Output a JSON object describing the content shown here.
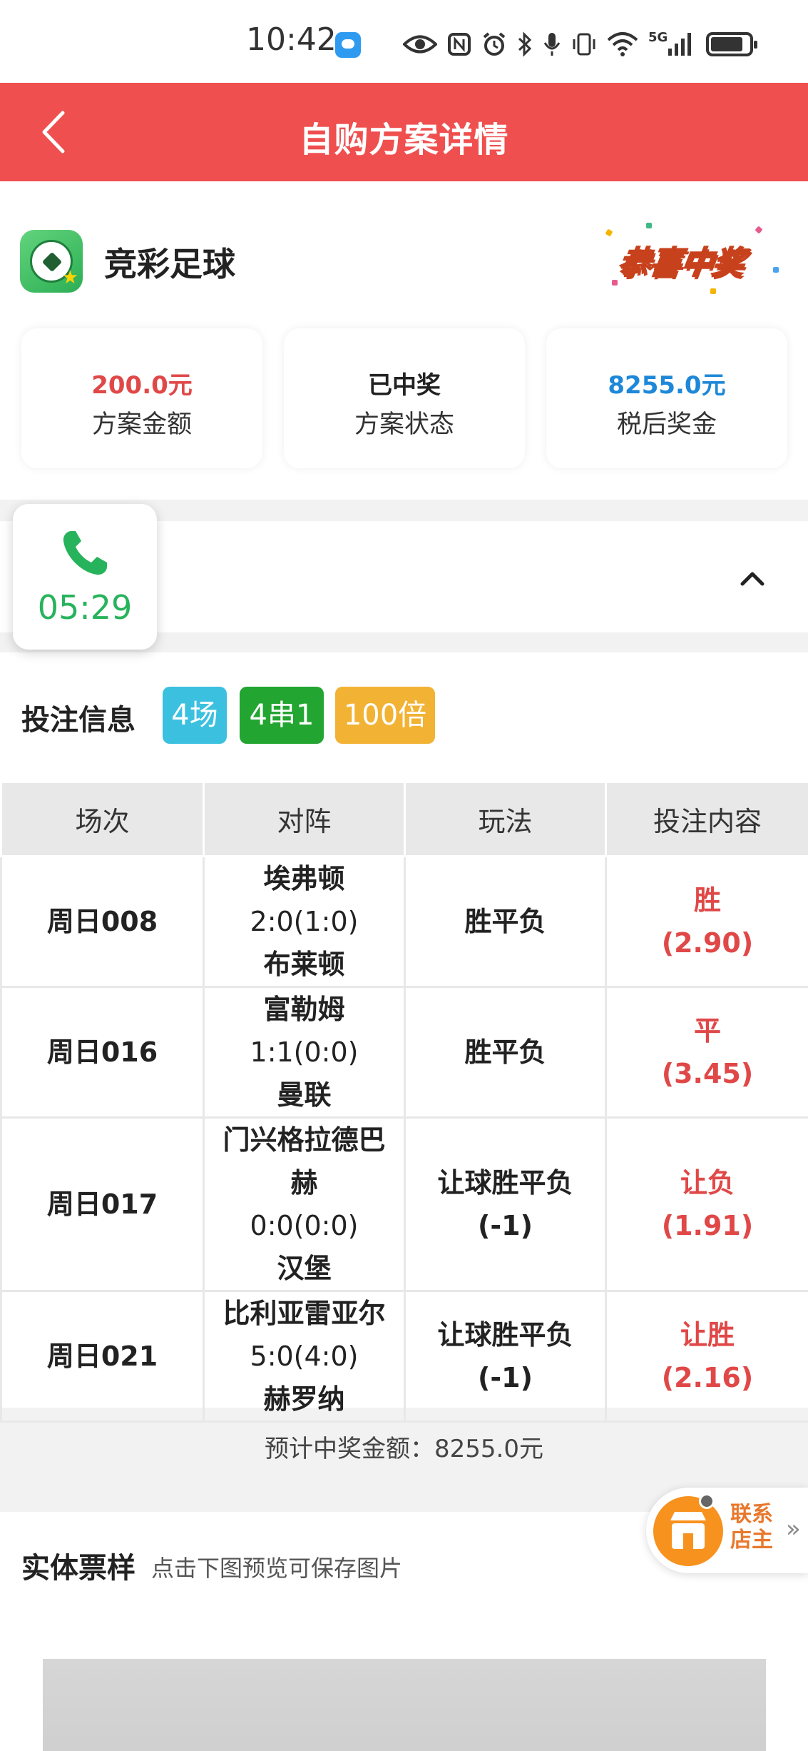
{
  "status_bar": {
    "time": "10:42",
    "network": "5G",
    "icons": [
      "eye-icon",
      "nfc-icon",
      "alarm-icon",
      "bluetooth-icon",
      "mic-icon",
      "vibrate-icon",
      "wifi-icon",
      "signal-icon",
      "battery-icon"
    ]
  },
  "nav": {
    "title": "自购方案详情"
  },
  "summary": {
    "lottery_name": "竞彩足球",
    "badge": "恭喜中奖",
    "cards": [
      {
        "value": "200.0元",
        "label": "方案金额",
        "color": "#e04848"
      },
      {
        "value": "已中奖",
        "label": "方案状态",
        "color": "#222222"
      },
      {
        "value": "8255.0元",
        "label": "税后奖金",
        "color": "#1e88d8"
      }
    ]
  },
  "call": {
    "timer": "05:29"
  },
  "bet": {
    "title": "投注信息",
    "tags": [
      {
        "text": "4场",
        "color": "#3cc0e0"
      },
      {
        "text": "4串1",
        "color": "#22a531"
      },
      {
        "text": "100倍",
        "color": "#f2b234"
      }
    ],
    "headers": [
      "场次",
      "对阵",
      "玩法",
      "投注内容"
    ],
    "rows": [
      {
        "match_no": "周日008",
        "home": "埃弗顿",
        "score": "2:0(1:0)",
        "away": "布莱顿",
        "play": "胜平负",
        "play_sub": "",
        "pick": "胜",
        "odds": "(2.90)"
      },
      {
        "match_no": "周日016",
        "home": "富勒姆",
        "score": "1:1(0:0)",
        "away": "曼联",
        "play": "胜平负",
        "play_sub": "",
        "pick": "平",
        "odds": "(3.45)"
      },
      {
        "match_no": "周日017",
        "home": "门兴格拉德巴",
        "home2": "赫",
        "score": "0:0(0:0)",
        "away": "汉堡",
        "play": "让球胜平负",
        "play_sub": "(-1)",
        "pick": "让负",
        "odds": "(1.91)"
      },
      {
        "match_no": "周日021",
        "home": "比利亚雷亚尔",
        "score": "5:0(4:0)",
        "away": "赫罗纳",
        "play": "让球胜平负",
        "play_sub": "(-1)",
        "pick": "让胜",
        "odds": "(2.16)"
      }
    ],
    "estimated_prize": "预计中奖金额：8255.0元"
  },
  "ticket": {
    "title": "实体票样",
    "hint": "点击下图预览可保存图片"
  },
  "contact": {
    "label": "联系店主"
  }
}
